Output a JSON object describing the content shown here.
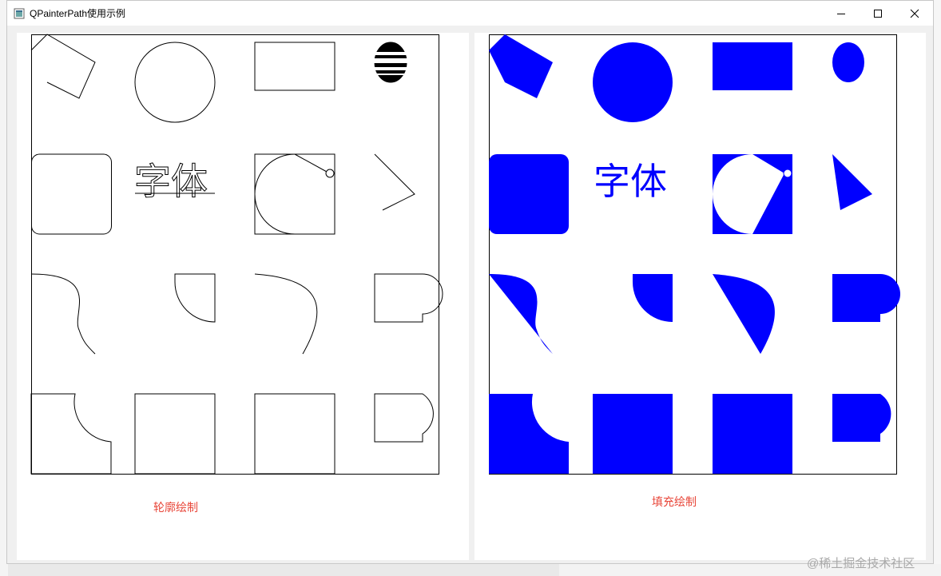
{
  "window": {
    "title": "QPainterPath使用示例",
    "controls": {
      "minimize": "minimize-icon",
      "maximize": "maximize-icon",
      "close": "close-icon"
    }
  },
  "panels": {
    "outline": {
      "caption": "轮廓绘制",
      "mode": "stroke"
    },
    "filled": {
      "caption": "填充绘制",
      "mode": "fill"
    }
  },
  "shape_grid": {
    "rows": 4,
    "cols": 4,
    "text_path": "字体"
  },
  "colors": {
    "stroke": "#000000",
    "fill": "#0000ff",
    "caption": "#e8473a",
    "watermark": "#a9a9a9"
  },
  "watermark": "@稀土掘金技术社区"
}
